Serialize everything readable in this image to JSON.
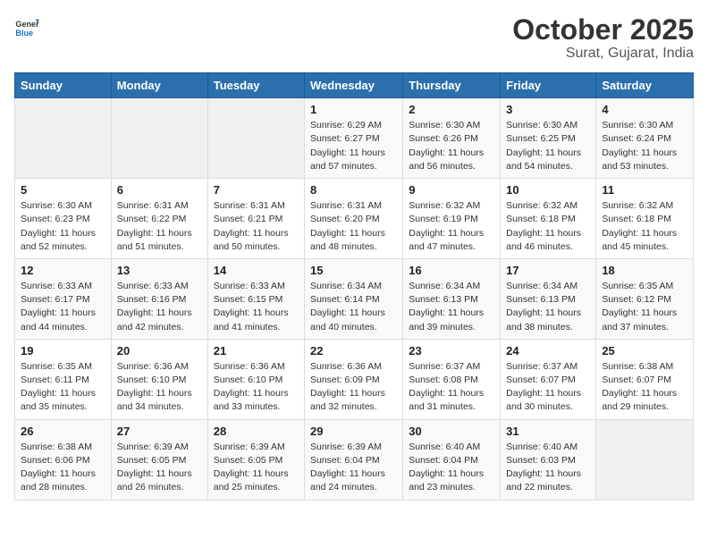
{
  "header": {
    "logo_general": "General",
    "logo_blue": "Blue",
    "month": "October 2025",
    "location": "Surat, Gujarat, India"
  },
  "weekdays": [
    "Sunday",
    "Monday",
    "Tuesday",
    "Wednesday",
    "Thursday",
    "Friday",
    "Saturday"
  ],
  "weeks": [
    [
      {
        "day": "",
        "info": ""
      },
      {
        "day": "",
        "info": ""
      },
      {
        "day": "",
        "info": ""
      },
      {
        "day": "1",
        "info": "Sunrise: 6:29 AM\nSunset: 6:27 PM\nDaylight: 11 hours and 57 minutes."
      },
      {
        "day": "2",
        "info": "Sunrise: 6:30 AM\nSunset: 6:26 PM\nDaylight: 11 hours and 56 minutes."
      },
      {
        "day": "3",
        "info": "Sunrise: 6:30 AM\nSunset: 6:25 PM\nDaylight: 11 hours and 54 minutes."
      },
      {
        "day": "4",
        "info": "Sunrise: 6:30 AM\nSunset: 6:24 PM\nDaylight: 11 hours and 53 minutes."
      }
    ],
    [
      {
        "day": "5",
        "info": "Sunrise: 6:30 AM\nSunset: 6:23 PM\nDaylight: 11 hours and 52 minutes."
      },
      {
        "day": "6",
        "info": "Sunrise: 6:31 AM\nSunset: 6:22 PM\nDaylight: 11 hours and 51 minutes."
      },
      {
        "day": "7",
        "info": "Sunrise: 6:31 AM\nSunset: 6:21 PM\nDaylight: 11 hours and 50 minutes."
      },
      {
        "day": "8",
        "info": "Sunrise: 6:31 AM\nSunset: 6:20 PM\nDaylight: 11 hours and 48 minutes."
      },
      {
        "day": "9",
        "info": "Sunrise: 6:32 AM\nSunset: 6:19 PM\nDaylight: 11 hours and 47 minutes."
      },
      {
        "day": "10",
        "info": "Sunrise: 6:32 AM\nSunset: 6:18 PM\nDaylight: 11 hours and 46 minutes."
      },
      {
        "day": "11",
        "info": "Sunrise: 6:32 AM\nSunset: 6:18 PM\nDaylight: 11 hours and 45 minutes."
      }
    ],
    [
      {
        "day": "12",
        "info": "Sunrise: 6:33 AM\nSunset: 6:17 PM\nDaylight: 11 hours and 44 minutes."
      },
      {
        "day": "13",
        "info": "Sunrise: 6:33 AM\nSunset: 6:16 PM\nDaylight: 11 hours and 42 minutes."
      },
      {
        "day": "14",
        "info": "Sunrise: 6:33 AM\nSunset: 6:15 PM\nDaylight: 11 hours and 41 minutes."
      },
      {
        "day": "15",
        "info": "Sunrise: 6:34 AM\nSunset: 6:14 PM\nDaylight: 11 hours and 40 minutes."
      },
      {
        "day": "16",
        "info": "Sunrise: 6:34 AM\nSunset: 6:13 PM\nDaylight: 11 hours and 39 minutes."
      },
      {
        "day": "17",
        "info": "Sunrise: 6:34 AM\nSunset: 6:13 PM\nDaylight: 11 hours and 38 minutes."
      },
      {
        "day": "18",
        "info": "Sunrise: 6:35 AM\nSunset: 6:12 PM\nDaylight: 11 hours and 37 minutes."
      }
    ],
    [
      {
        "day": "19",
        "info": "Sunrise: 6:35 AM\nSunset: 6:11 PM\nDaylight: 11 hours and 35 minutes."
      },
      {
        "day": "20",
        "info": "Sunrise: 6:36 AM\nSunset: 6:10 PM\nDaylight: 11 hours and 34 minutes."
      },
      {
        "day": "21",
        "info": "Sunrise: 6:36 AM\nSunset: 6:10 PM\nDaylight: 11 hours and 33 minutes."
      },
      {
        "day": "22",
        "info": "Sunrise: 6:36 AM\nSunset: 6:09 PM\nDaylight: 11 hours and 32 minutes."
      },
      {
        "day": "23",
        "info": "Sunrise: 6:37 AM\nSunset: 6:08 PM\nDaylight: 11 hours and 31 minutes."
      },
      {
        "day": "24",
        "info": "Sunrise: 6:37 AM\nSunset: 6:07 PM\nDaylight: 11 hours and 30 minutes."
      },
      {
        "day": "25",
        "info": "Sunrise: 6:38 AM\nSunset: 6:07 PM\nDaylight: 11 hours and 29 minutes."
      }
    ],
    [
      {
        "day": "26",
        "info": "Sunrise: 6:38 AM\nSunset: 6:06 PM\nDaylight: 11 hours and 28 minutes."
      },
      {
        "day": "27",
        "info": "Sunrise: 6:39 AM\nSunset: 6:05 PM\nDaylight: 11 hours and 26 minutes."
      },
      {
        "day": "28",
        "info": "Sunrise: 6:39 AM\nSunset: 6:05 PM\nDaylight: 11 hours and 25 minutes."
      },
      {
        "day": "29",
        "info": "Sunrise: 6:39 AM\nSunset: 6:04 PM\nDaylight: 11 hours and 24 minutes."
      },
      {
        "day": "30",
        "info": "Sunrise: 6:40 AM\nSunset: 6:04 PM\nDaylight: 11 hours and 23 minutes."
      },
      {
        "day": "31",
        "info": "Sunrise: 6:40 AM\nSunset: 6:03 PM\nDaylight: 11 hours and 22 minutes."
      },
      {
        "day": "",
        "info": ""
      }
    ]
  ]
}
